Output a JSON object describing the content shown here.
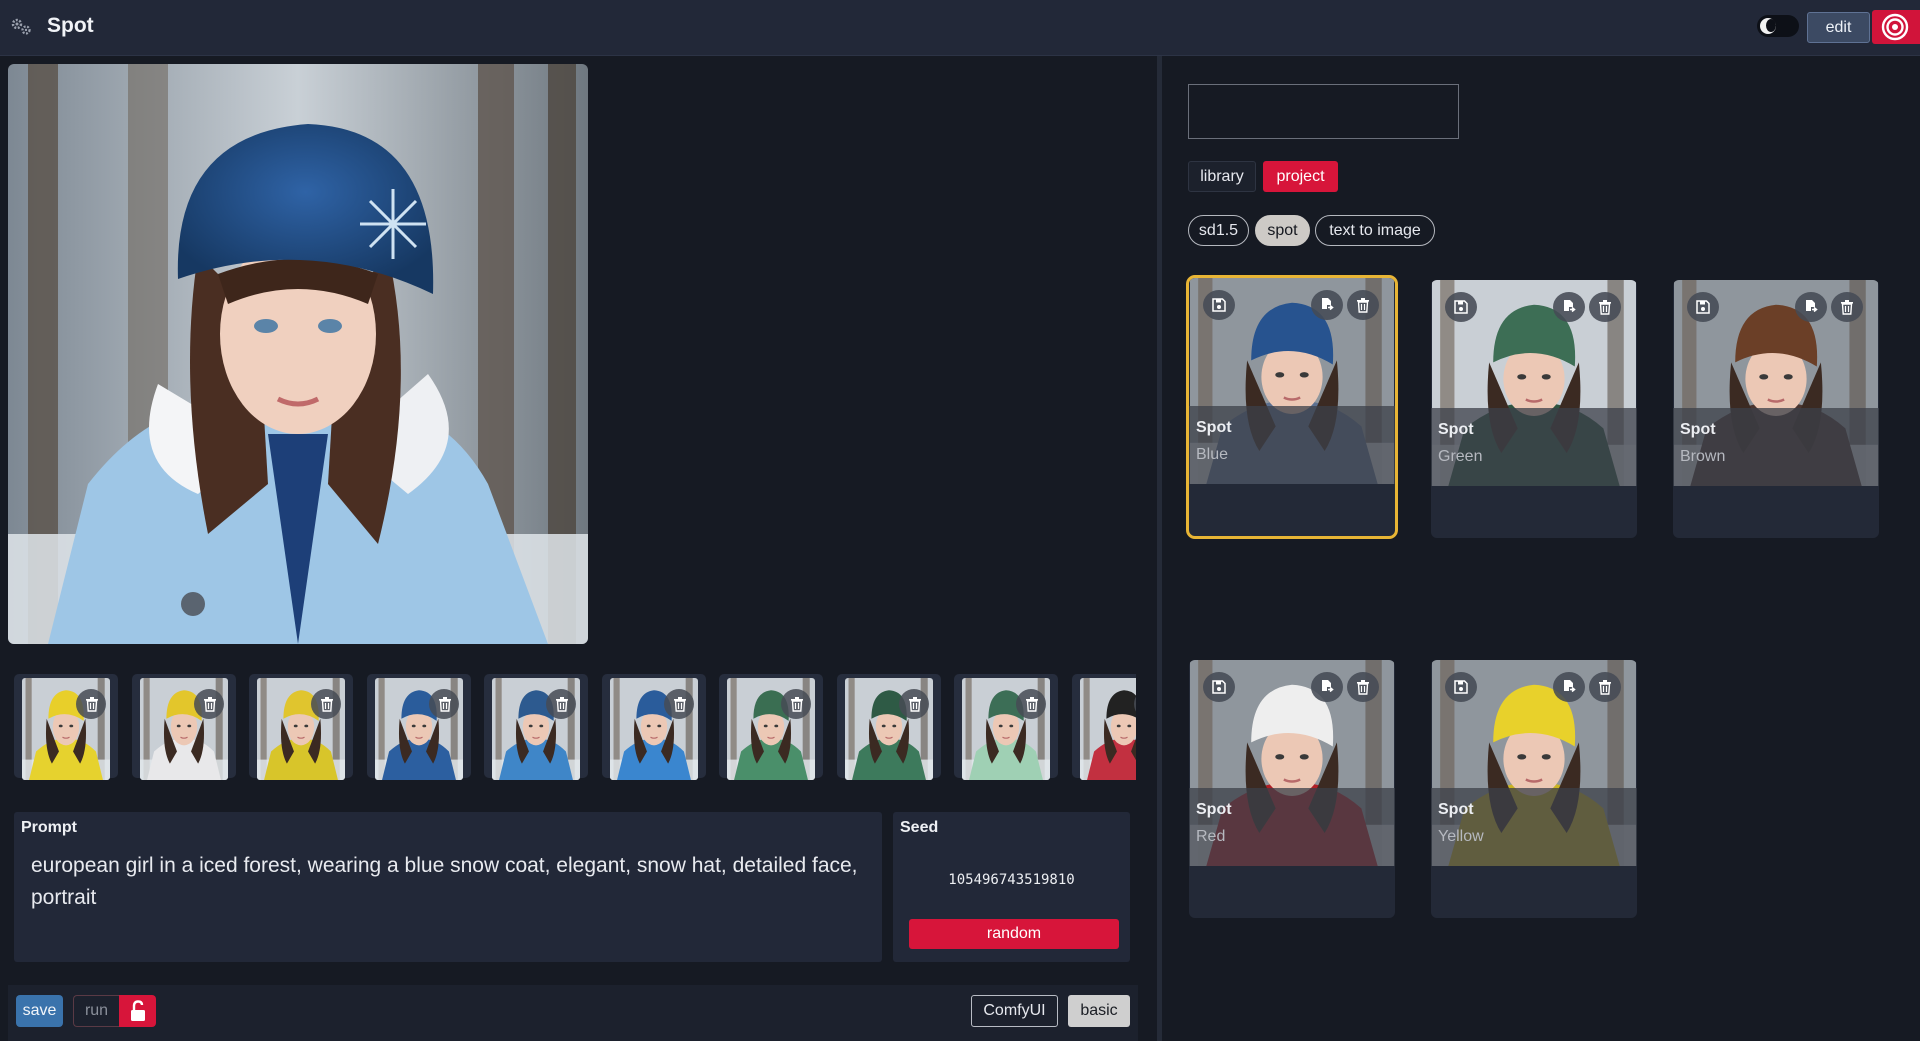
{
  "header": {
    "app_title": "Spot",
    "edit_label": "edit",
    "accent_color": "#d7153a"
  },
  "main": {
    "thumbnails": [
      {
        "hat": "#e8cf2a",
        "coat": "#e6d22e"
      },
      {
        "hat": "#e3c62b",
        "coat": "#e8e8ea"
      },
      {
        "hat": "#e0c52e",
        "coat": "#d8c52a"
      },
      {
        "hat": "#2a5c9b",
        "coat": "#2c5fa0"
      },
      {
        "hat": "#2d5a8f",
        "coat": "#3f86c8"
      },
      {
        "hat": "#2a5c9b",
        "coat": "#3a86cf"
      },
      {
        "hat": "#3a6e52",
        "coat": "#4a8f6a"
      },
      {
        "hat": "#2e5a45",
        "coat": "#3d7a5c"
      },
      {
        "hat": "#3c6e56",
        "coat": "#9fd0b4"
      },
      {
        "hat": "#222222",
        "coat": "#c23040"
      }
    ],
    "prompt": {
      "label": "Prompt",
      "text": "european girl in a iced forest, wearing a blue snow coat, elegant, snow hat, detailed face, portrait"
    },
    "seed": {
      "label": "Seed",
      "value": "105496743519810",
      "random_label": "random"
    },
    "footer": {
      "save_label": "save",
      "run_label": "run",
      "comfy_label": "ComfyUI",
      "basic_label": "basic"
    }
  },
  "library": {
    "search_value": "",
    "tabs": [
      {
        "label": "library",
        "active": false
      },
      {
        "label": "project",
        "active": true
      }
    ],
    "tags": [
      "sd1.5",
      "spot",
      "text to image"
    ],
    "cards": [
      {
        "title": "Spot",
        "subtitle": "Blue",
        "selected": true,
        "hat": "#27538f",
        "coat": "#5c7090"
      },
      {
        "title": "Spot",
        "subtitle": "Green",
        "selected": false,
        "hat": "#3d6e55",
        "coat": "#2f5340"
      },
      {
        "title": "Spot",
        "subtitle": "Brown",
        "selected": false,
        "hat": "#6b3f27",
        "coat": "#4a3530"
      },
      {
        "title": "Spot",
        "subtitle": "Red",
        "selected": false,
        "hat": "#eeeeee",
        "coat": "#b01e25"
      },
      {
        "title": "Spot",
        "subtitle": "Yellow",
        "selected": false,
        "hat": "#e8d12b",
        "coat": "#c9b322"
      }
    ]
  }
}
